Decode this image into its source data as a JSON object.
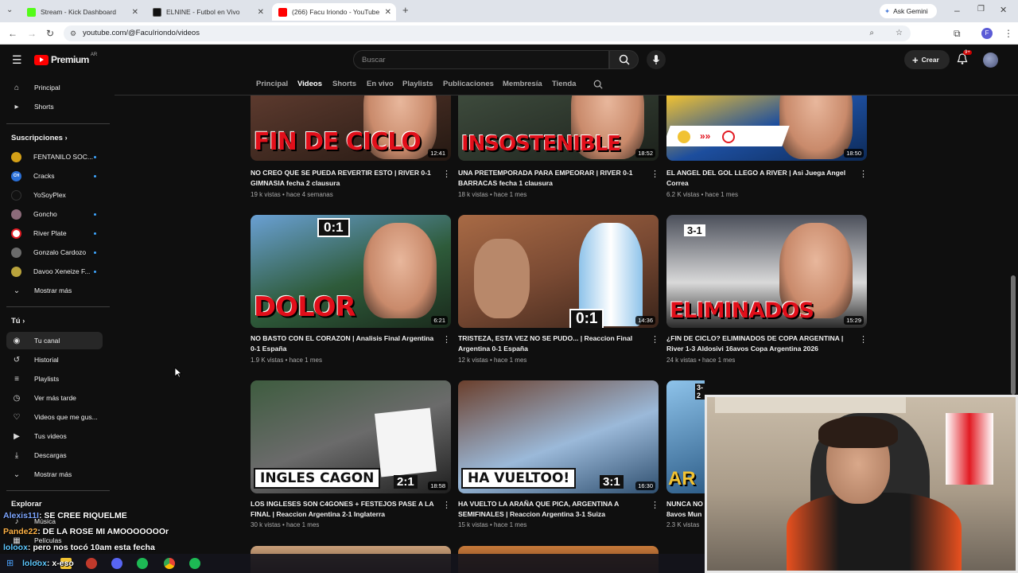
{
  "browser": {
    "tabs": [
      {
        "title": "Stream - Kick Dashboard",
        "color": "#53fc18"
      },
      {
        "title": "ELNINE - Futbol en Vivo",
        "color": "#111111"
      },
      {
        "title": "(266) Facu Iriondo - YouTube",
        "color": "#ff0000"
      }
    ],
    "gemini_label": "Ask Gemini",
    "url": "youtube.com/@FacuIriondo/videos",
    "profile_initial": "F"
  },
  "header": {
    "logo_text": "Premium",
    "region": "AR",
    "search_placeholder": "Buscar",
    "create_label": "Crear",
    "notif_badge": "9+"
  },
  "sidebar": {
    "main": [
      {
        "label": "Principal",
        "icon": "home-icon",
        "glyph": "⌂"
      },
      {
        "label": "Shorts",
        "icon": "shorts-icon",
        "glyph": "▸"
      }
    ],
    "subs_title": "Suscripciones",
    "subs": [
      {
        "label": "FENTANILO SOC...",
        "color": "#d4a017"
      },
      {
        "label": "Cracks",
        "color": "#2a6fd6",
        "avatar_text": "CH"
      },
      {
        "label": "YoSoyPlex",
        "color": "#111111"
      },
      {
        "label": "Goncho",
        "color": "#8c6b7a"
      },
      {
        "label": "River Plate",
        "color": "#e21b23"
      },
      {
        "label": "Gonzalo Cardozo",
        "color": "#6b6b6b"
      },
      {
        "label": "Davoo Xeneize F...",
        "color": "#b9a33c"
      }
    ],
    "subs_more": "Mostrar más",
    "you_title": "Tú",
    "you": [
      {
        "label": "Tu canal",
        "icon": "channel-icon",
        "glyph": "◉"
      },
      {
        "label": "Historial",
        "icon": "history-icon",
        "glyph": "↺"
      },
      {
        "label": "Playlists",
        "icon": "playlist-icon",
        "glyph": "≡"
      },
      {
        "label": "Ver más tarde",
        "icon": "clock-icon",
        "glyph": "◷"
      },
      {
        "label": "Videos que me gus...",
        "icon": "like-icon",
        "glyph": "👍"
      },
      {
        "label": "Tus videos",
        "icon": "video-icon",
        "glyph": "▶"
      },
      {
        "label": "Descargas",
        "icon": "download-icon",
        "glyph": "⤓"
      },
      {
        "label": "Mostrar más",
        "icon": "chevron-down-icon",
        "glyph": "⌄"
      }
    ],
    "explore_title": "Explorar",
    "explore": [
      {
        "label": "Música"
      },
      {
        "label": "Películas"
      }
    ]
  },
  "channel_tabs": [
    "Principal",
    "Videos",
    "Shorts",
    "En vivo",
    "Playlists",
    "Publicaciones",
    "Membresía",
    "Tienda"
  ],
  "active_tab": "Videos",
  "videos": [
    {
      "title": "NO CREO QUE SE PUEDA REVERTIR ESTO | RIVER 0-1 GIMNASIA fecha 2 clausura",
      "meta": "19 k vistas • hace 4 semanas",
      "duration": "12:41",
      "overlay": "FIN DE CICLO",
      "bg": "#5c3a2e"
    },
    {
      "title": "UNA PRETEMPORADA PARA EMPEORAR | RIVER 0-1 BARRACAS fecha 1 clausura",
      "meta": "18 k vistas • hace 1 mes",
      "duration": "18:52",
      "overlay": "INSOSTENIBLE",
      "bg": "#3d4a3c"
    },
    {
      "title": "EL ANGEL DEL GOL LLEGO A RIVER | Asi Juega Angel Correa",
      "meta": "6.2 K vistas • hace 1 mes",
      "duration": "18:50",
      "overlay": "",
      "bg": "#1d4e9e"
    },
    {
      "title": "NO BASTO CON EL CORAZON | Analisis Final Argentina 0-1 España",
      "meta": "1.9 K vistas • hace 1 mes",
      "duration": "6:21",
      "overlay": "DOLOR",
      "bg": "#2e5b3a",
      "badge": "0:1"
    },
    {
      "title": "TRISTEZA, ESTA VEZ NO SE PUDO... | Reaccion Final Argentina 0-1 España",
      "meta": "12 k vistas • hace 1 mes",
      "duration": "14:36",
      "overlay": "",
      "bg": "#7a4a33",
      "badge": "0:1"
    },
    {
      "title": "¿FIN DE CICLO? ELIMINADOS DE COPA ARGENTINA | River 1-3 Aldosivi 16avos Copa Argentina 2026",
      "meta": "24 k vistas • hace 1 mes",
      "duration": "15:29",
      "overlay": "ELIMINADOS",
      "bg": "#4b4f5a",
      "badge": "3-1"
    },
    {
      "title": "LOS INGLESES SON C4GONES + FESTEJOS PASE A LA FINAL | Reaccion Argentina 2-1 Inglaterra",
      "meta": "30 k vistas • hace 1 mes",
      "duration": "18:58",
      "overlay": "INGLES CAGON",
      "bg": "#3e5c3f",
      "badge": "2:1"
    },
    {
      "title": "HA VUELTO LA ARAÑA QUE PICA, ARGENTINA A SEMIFINALES | Reaccion Argentina 3-1 Suiza",
      "meta": "15 k vistas • hace 1 mes",
      "duration": "16:30",
      "overlay": "HA VUELTOO!",
      "bg": "#6b3f2c",
      "badge": "3:1"
    },
    {
      "title": "NUNCA NO",
      "title2": "8avos Mun",
      "meta": "2.3 K vistas",
      "duration": "",
      "overlay": "AR",
      "bg": "#2f5f8a",
      "badge": "3-2"
    }
  ],
  "chat": [
    {
      "user": "Alexis11I",
      "text": ": SE CREE RIQUELME",
      "color": "#7ea7ff"
    },
    {
      "user": "Pande22",
      "text": ": DE LA ROSE MI AMOOOOOOOr",
      "color": "#ffb347"
    },
    {
      "user": "loloox",
      "text": ": pero nos tocó 10am esta fecha",
      "color": "#5ec8ff"
    },
    {
      "user": "loloox",
      "text": ": x-eso",
      "color": "#5ec8ff"
    }
  ]
}
